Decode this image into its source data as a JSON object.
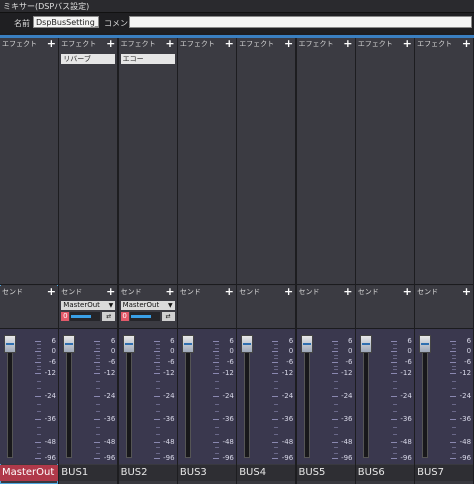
{
  "window": {
    "title": "ミキサー(DSPバス設定)"
  },
  "header": {
    "name_label": "名前",
    "name_value": "DspBusSetting_0",
    "comment_label": "コメント",
    "comment_value": ""
  },
  "strip_labels": {
    "effect": "エフェクト",
    "send": "センド",
    "add": "+"
  },
  "scale": [
    "6",
    "0",
    "-6",
    "-12",
    "-24",
    "-36",
    "-48",
    "-96"
  ],
  "strips": [
    {
      "name": "MasterOut",
      "effects": [],
      "send": null
    },
    {
      "name": "BUS1",
      "effects": [
        "リバーブ"
      ],
      "send": {
        "target": "MasterOut",
        "value": "0",
        "arrow": "▼",
        "mode": "⇄"
      }
    },
    {
      "name": "BUS2",
      "effects": [
        "エコー"
      ],
      "send": {
        "target": "MasterOut",
        "value": "0",
        "arrow": "▼",
        "mode": "⇄"
      }
    },
    {
      "name": "BUS3",
      "effects": [],
      "send": null
    },
    {
      "name": "BUS4",
      "effects": [],
      "send": null
    },
    {
      "name": "BUS5",
      "effects": [],
      "send": null
    },
    {
      "name": "BUS6",
      "effects": [],
      "send": null
    },
    {
      "name": "BUS7",
      "effects": [],
      "send": null
    }
  ],
  "colors": {
    "accent": "#3a7fc0",
    "master_tab": "#b0394a",
    "send_value": "#e35a6a",
    "slider_fill": "#3aa0e8"
  }
}
